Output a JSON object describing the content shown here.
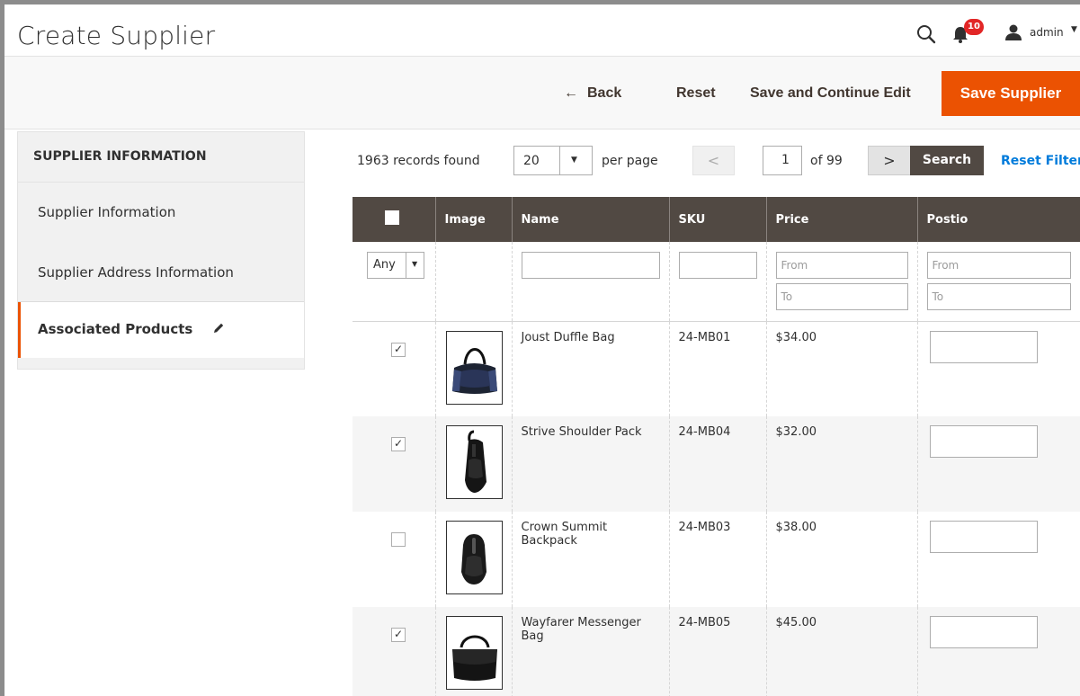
{
  "header": {
    "title": "Create Supplier",
    "notification_count": "10",
    "user_name": "admin"
  },
  "actions": {
    "back_label": "Back",
    "reset_label": "Reset",
    "save_continue_label": "Save and Continue Edit",
    "save_label": "Save Supplier"
  },
  "sidebar": {
    "heading": "SUPPLIER INFORMATION",
    "items": [
      {
        "label": "Supplier Information"
      },
      {
        "label": "Supplier Address Information"
      },
      {
        "label": "Associated Products"
      }
    ]
  },
  "toolbar": {
    "records_text": "1963 records found",
    "per_page_value": "20",
    "per_page_label": "per page",
    "current_page": "1",
    "of_pages": "of 99",
    "search_label": "Search",
    "reset_filter_label": "Reset Filter"
  },
  "grid": {
    "columns": [
      "Image",
      "Name",
      "SKU",
      "Price",
      "Postio"
    ],
    "filters": {
      "any_value": "Any",
      "from_placeholder": "From",
      "to_placeholder": "To"
    },
    "rows": [
      {
        "checked": true,
        "name": "Joust Duffle Bag",
        "sku": "24-MB01",
        "price": "$34.00"
      },
      {
        "checked": true,
        "name": "Strive Shoulder Pack",
        "sku": "24-MB04",
        "price": "$32.00"
      },
      {
        "checked": false,
        "name": "Crown Summit Backpack",
        "sku": "24-MB03",
        "price": "$38.00"
      },
      {
        "checked": true,
        "name": "Wayfarer Messenger Bag",
        "sku": "24-MB05",
        "price": "$45.00"
      }
    ]
  },
  "colors": {
    "accent": "#eb5202",
    "grid_header": "#514943",
    "link": "#007bdb"
  }
}
